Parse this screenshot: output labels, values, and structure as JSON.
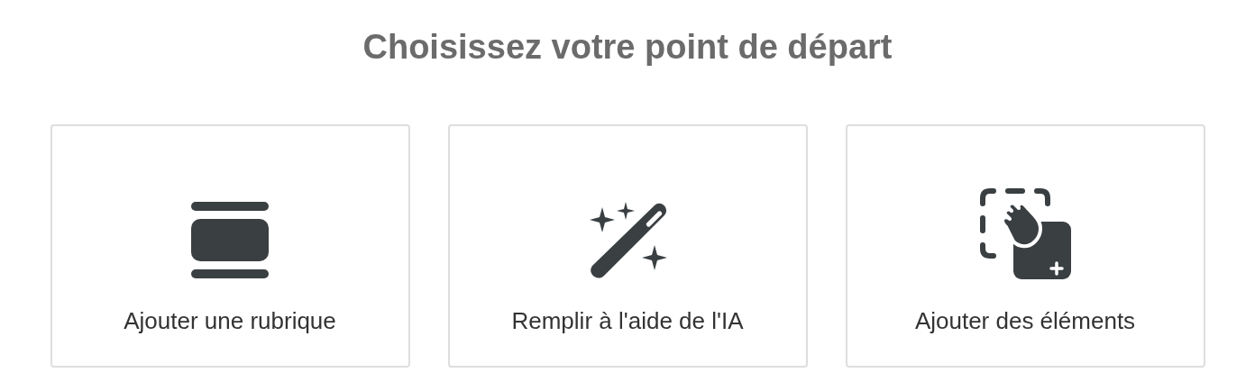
{
  "heading": "Choisissez votre point de départ",
  "options": [
    {
      "kind": "section",
      "label": "Ajouter une rubrique"
    },
    {
      "kind": "ai",
      "label": "Remplir à l'aide de l'IA"
    },
    {
      "kind": "elements",
      "label": "Ajouter des éléments"
    }
  ]
}
